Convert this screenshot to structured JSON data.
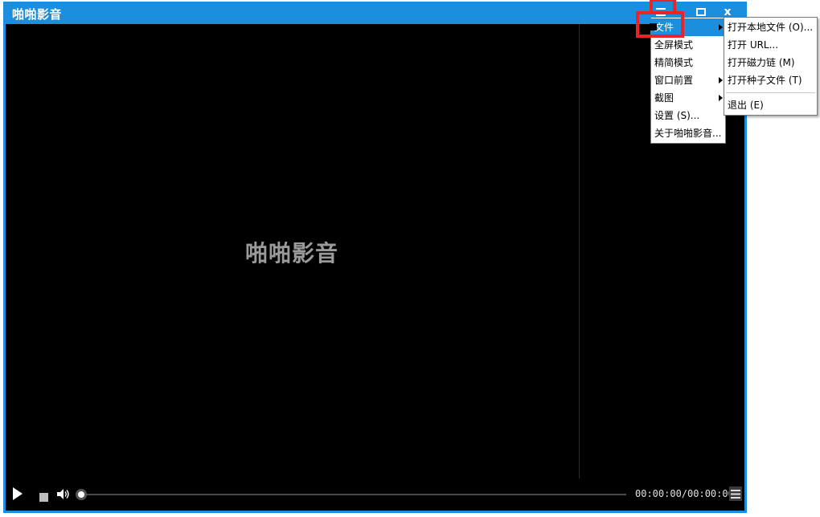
{
  "window": {
    "title": "啪啪影音",
    "controls": {
      "menu_icon": "hamburger-icon",
      "maximize_icon": "maximize-icon",
      "close_label": "x"
    }
  },
  "player": {
    "watermark": "啪啪影音",
    "time": "00:00:00/00:00:00",
    "progress": 0
  },
  "main_menu": {
    "items": [
      {
        "label": "文件",
        "has_submenu": true,
        "active": true
      },
      {
        "label": "全屏模式",
        "has_submenu": false
      },
      {
        "label": "精简模式",
        "has_submenu": false
      },
      {
        "label": "窗口前置",
        "has_submenu": true
      },
      {
        "label": "截图",
        "has_submenu": true
      },
      {
        "label": "设置 (S)...",
        "has_submenu": false
      },
      {
        "label": "关于啪啪影音...",
        "has_submenu": false
      }
    ]
  },
  "file_submenu": {
    "items": [
      {
        "label": "打开本地文件 (O)..."
      },
      {
        "label": "打开 URL..."
      },
      {
        "label": "打开磁力链 (M)"
      },
      {
        "label": "打开种子文件 (T)"
      },
      {
        "label": "退出 (E)"
      }
    ]
  },
  "colors": {
    "accent": "#1b8fde",
    "highlight": "#e8242b",
    "video_bg": "#000000"
  }
}
